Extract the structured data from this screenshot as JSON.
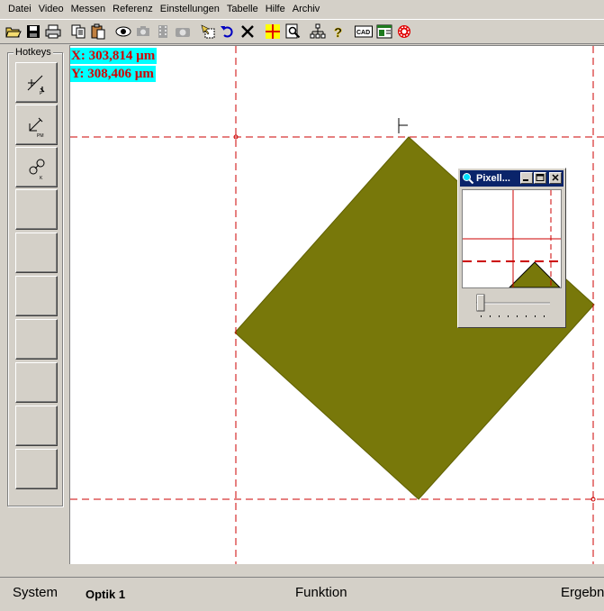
{
  "menu": {
    "items": [
      "Datei",
      "Video",
      "Messen",
      "Referenz",
      "Einstellungen",
      "Tabelle",
      "Hilfe",
      "Archiv"
    ]
  },
  "toolbar": {
    "buttons": [
      "open-icon",
      "save-icon",
      "print-icon",
      "copy-icon",
      "paste-icon",
      "eye-icon",
      "camera-icon",
      "film-icon",
      "camera2-icon",
      "select-icon",
      "undo-icon",
      "delete-icon",
      "crosshair-icon",
      "zoom-icon",
      "tree-icon",
      "help-icon",
      "cad-icon",
      "excel-icon",
      "gear-icon"
    ],
    "cad_label": "CAD"
  },
  "hotkeys": {
    "title": "Hotkeys",
    "buttons": [
      "point-measure-icon",
      "line-measure-icon",
      "circle-link-icon",
      "",
      "",
      "",
      "",
      "",
      "",
      ""
    ]
  },
  "canvas": {
    "x_readout": "X: 303,814 µm",
    "y_readout": "Y: 308,406 µm",
    "shape_color": "#78780a",
    "guide_color": "#cc0000"
  },
  "pixel_window": {
    "title": "Pixell..."
  },
  "statusbar": {
    "system": "System",
    "optik": "Optik 1",
    "funktion": "Funktion",
    "ergebnis": "Ergebn"
  }
}
